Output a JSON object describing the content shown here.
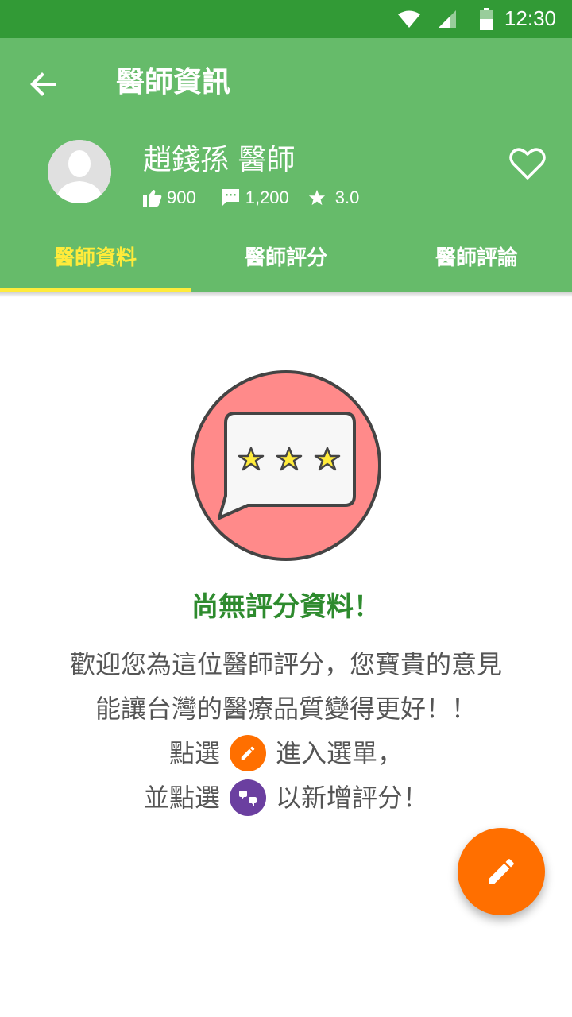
{
  "status_bar": {
    "time": "12:30"
  },
  "header": {
    "title": "醫師資訊",
    "doctor_name": "趙錢孫 醫師",
    "likes": "900",
    "comments": "1,200",
    "rating": "3.0"
  },
  "tabs": [
    {
      "label": "醫師資料",
      "active": true
    },
    {
      "label": "醫師評分",
      "active": false
    },
    {
      "label": "醫師評論",
      "active": false
    }
  ],
  "empty_state": {
    "title": "尚無評分資料！",
    "line1": "歡迎您為這位醫師評分，您寶貴的意見",
    "line2": "能讓台灣的醫療品質變得更好！！",
    "line3_before": "點選",
    "line3_after": "進入選單，",
    "line4_before": "並點選",
    "line4_after": "以新增評分！"
  },
  "colors": {
    "status_bar": "#329A36",
    "app_bar": "#66BB6A",
    "active_tab": "#FFEB3B",
    "empty_title": "#2E8B2E",
    "fab": "#FF6F00",
    "purple_badge": "#6B3FA0",
    "illustration_circle": "#FF8A8A"
  },
  "icons": {
    "back": "arrow-back-icon",
    "heart": "heart-outline-icon",
    "like": "thumb-up-icon",
    "comment": "comment-icon",
    "star": "star-icon",
    "fab": "edit-pencil-icon",
    "rate": "rate-quote-icon"
  }
}
